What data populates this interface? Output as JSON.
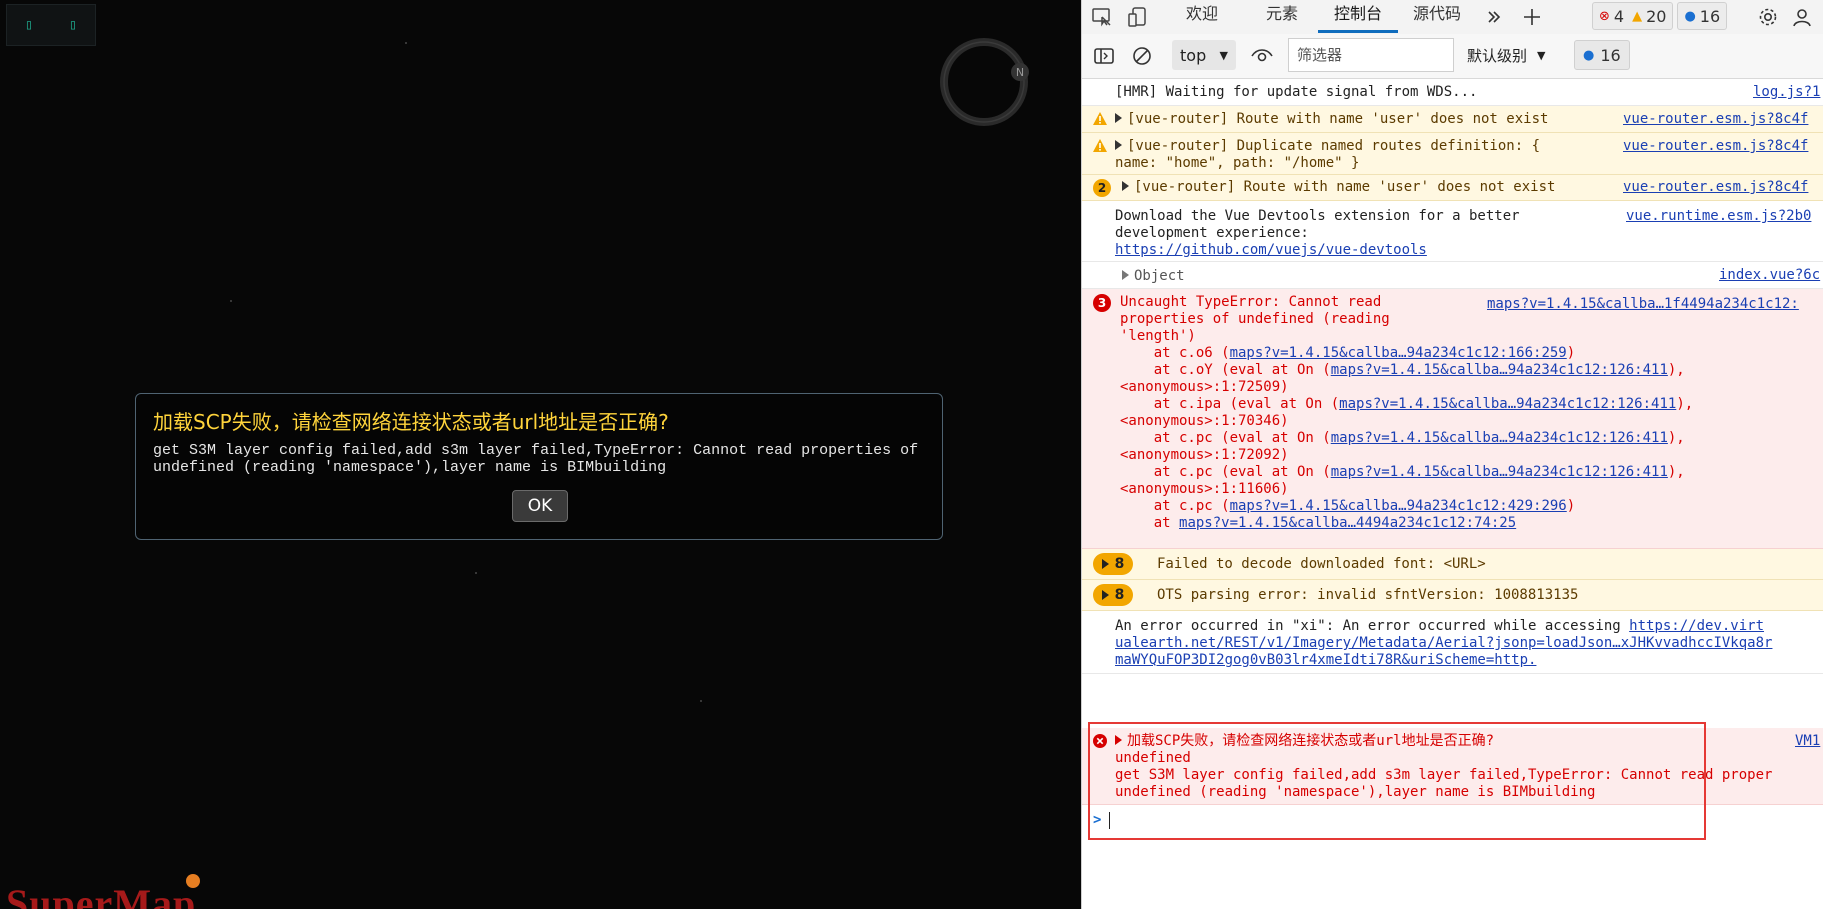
{
  "app": {
    "toolbar_glyphs": [
      "▯",
      "▯"
    ],
    "compass_letter": "N",
    "logo_text": "SuperMap"
  },
  "dialog": {
    "title": "加载SCP失败，请检查网络连接状态或者url地址是否正确?",
    "message": "get S3M layer config failed,add s3m layer failed,TypeError: Cannot read properties of undefined (reading 'namespace'),layer name is BIMbuilding",
    "ok_label": "OK"
  },
  "devtools": {
    "tabs": [
      {
        "label": "欢迎",
        "active": false
      },
      {
        "label": "元素",
        "active": false
      },
      {
        "label": "控制台",
        "active": true
      },
      {
        "label": "源代码",
        "active": false
      }
    ],
    "error_count": "4",
    "warning_count": "20",
    "info_count": "16",
    "context": "top",
    "filter_placeholder": "筛选器",
    "level_label": "默认级别",
    "issues_count": "16",
    "colors": {
      "accent": "#0f6cbd",
      "error": "#d60000",
      "warning": "#f2a600",
      "link": "#1a3fb3"
    }
  },
  "console": {
    "hmr": {
      "text": "[HMR] Waiting for update signal from WDS...",
      "src": "log.js?1"
    },
    "warn1": {
      "text": "[vue-router] Route with name 'user' does not exist",
      "src": "vue-router.esm.js?8c4f"
    },
    "warn2": {
      "line1": "[vue-router] Duplicate named routes definition: {",
      "line2": "name: \"home\", path: \"/home\" }",
      "src": "vue-router.esm.js?8c4f"
    },
    "warn3": {
      "count": "2",
      "text": "[vue-router] Route with name 'user' does not exist",
      "src": "vue-router.esm.js?8c4f"
    },
    "devtools_msg": {
      "line1": "Download the Vue Devtools extension for a better",
      "line2": "development experience:",
      "link": "https://github.com/vuejs/vue-devtools",
      "src": "vue.runtime.esm.js?2b0"
    },
    "object": {
      "text": "Object",
      "src": "index.vue?6c"
    },
    "type_error": {
      "count": "3",
      "line1": "Uncaught TypeError: Cannot read",
      "line2": "properties of undefined (reading",
      "line3": "'length')",
      "src": "maps?v=1.4.15&callba…1f4494a234c1c12:",
      "stack": [
        {
          "pre": "    at c.o6 (",
          "link": "maps?v=1.4.15&callba…94a234c1c12:166:259",
          "post": ")"
        },
        {
          "pre": "    at c.oY (eval at On (",
          "link": "maps?v=1.4.15&callba…94a234c1c12:126:411",
          "post": "),"
        },
        {
          "pre": "<anonymous>:1:72509)",
          "link": "",
          "post": ""
        },
        {
          "pre": "    at c.ipa (eval at On (",
          "link": "maps?v=1.4.15&callba…94a234c1c12:126:411",
          "post": "),"
        },
        {
          "pre": "<anonymous>:1:70346)",
          "link": "",
          "post": ""
        },
        {
          "pre": "    at c.pc (eval at On (",
          "link": "maps?v=1.4.15&callba…94a234c1c12:126:411",
          "post": "),"
        },
        {
          "pre": "<anonymous>:1:72092)",
          "link": "",
          "post": ""
        },
        {
          "pre": "    at c.pc (eval at On (",
          "link": "maps?v=1.4.15&callba…94a234c1c12:126:411",
          "post": "),"
        },
        {
          "pre": "<anonymous>:1:11606)",
          "link": "",
          "post": ""
        },
        {
          "pre": "    at c.pc (",
          "link": "maps?v=1.4.15&callba…94a234c1c12:429:296",
          "post": ")"
        },
        {
          "pre": "    at ",
          "link": "maps?v=1.4.15&callba…4494a234c1c12:74:25",
          "post": ""
        }
      ]
    },
    "font_warn": {
      "count": "8",
      "text": "Failed to decode downloaded font: <URL>"
    },
    "ots_warn": {
      "count": "8",
      "text": "OTS parsing error: invalid sfntVersion: 1008813135"
    },
    "xi_error": {
      "prefix": "An error occurred in \"xi\": An error occurred while accessing ",
      "link1": "https://dev.virt",
      "link2": "ualearth.net/REST/v1/Imagery/Metadata/Aerial?jsonp=loadJson…xJHKvvadhccIVkqa8r",
      "link3": "maWYQuFOP3DI2gog0vB03lr4xmeIdti78R&uriScheme=http."
    },
    "scp_error": {
      "title": "加载SCP失败，请检查网络连接状态或者url地址是否正确?",
      "line2": "undefined",
      "line3": "get S3M layer config failed,add s3m layer failed,TypeError: Cannot read proper",
      "line4": "undefined (reading 'namespace'),layer name is BIMbuilding",
      "src": "VM1"
    },
    "prompt": ">"
  }
}
